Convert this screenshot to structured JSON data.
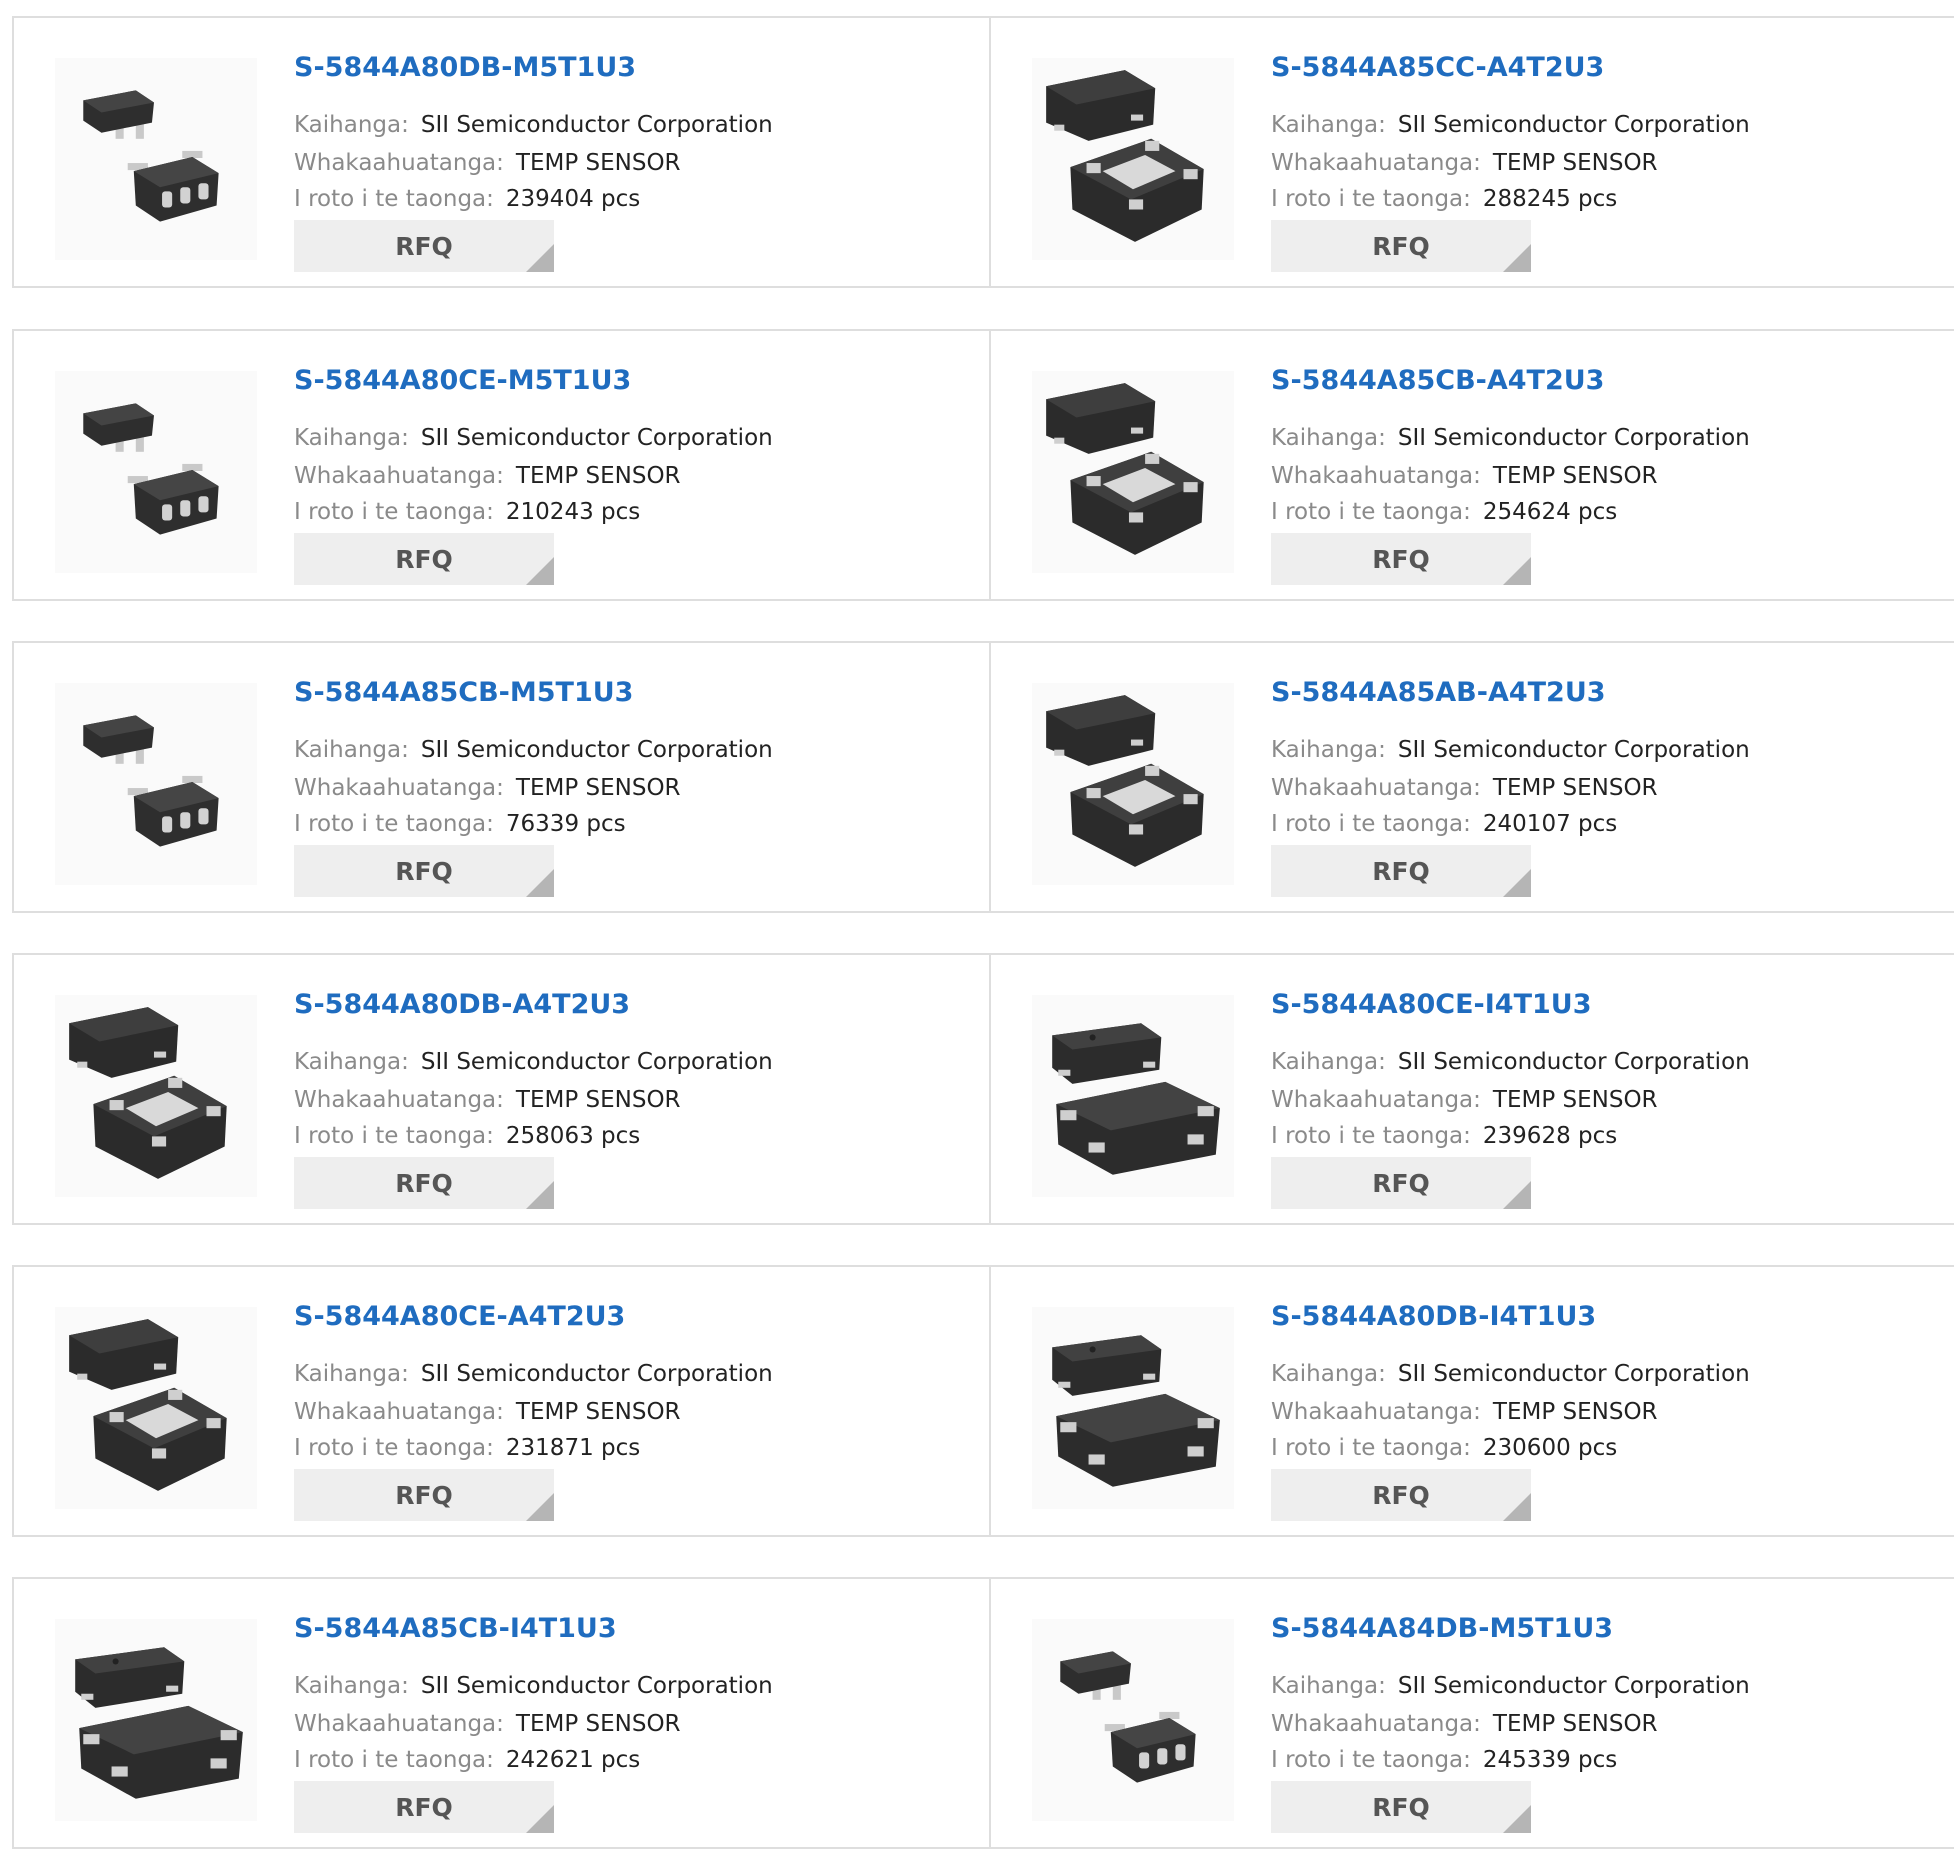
{
  "labels": {
    "manufacturer": "Kaihanga:",
    "description": "Whakaahuatanga:",
    "stock": "I roto i te taonga:",
    "rfq": "RFQ"
  },
  "rows": [
    [
      {
        "part": "S-5844A80DB-M5T1U3",
        "manufacturer": "SII Semiconductor Corporation",
        "description": "TEMP SENSOR",
        "stock": "239404 pcs",
        "image": "sot23-5-package-icon"
      },
      {
        "part": "S-5844A85CC-A4T2U3",
        "manufacturer": "SII Semiconductor Corporation",
        "description": "TEMP SENSOR",
        "stock": "288245 pcs",
        "image": "snt-4a-package-icon"
      }
    ],
    [
      {
        "part": "S-5844A80CE-M5T1U3",
        "manufacturer": "SII Semiconductor Corporation",
        "description": "TEMP SENSOR",
        "stock": "210243 pcs",
        "image": "sot23-5-package-icon"
      },
      {
        "part": "S-5844A85CB-A4T2U3",
        "manufacturer": "SII Semiconductor Corporation",
        "description": "TEMP SENSOR",
        "stock": "254624 pcs",
        "image": "snt-4a-package-icon"
      }
    ],
    [
      {
        "part": "S-5844A85CB-M5T1U3",
        "manufacturer": "SII Semiconductor Corporation",
        "description": "TEMP SENSOR",
        "stock": "76339 pcs",
        "image": "sot23-5-package-icon"
      },
      {
        "part": "S-5844A85AB-A4T2U3",
        "manufacturer": "SII Semiconductor Corporation",
        "description": "TEMP SENSOR",
        "stock": "240107 pcs",
        "image": "snt-4a-package-icon"
      }
    ],
    [
      {
        "part": "S-5844A80DB-A4T2U3",
        "manufacturer": "SII Semiconductor Corporation",
        "description": "TEMP SENSOR",
        "stock": "258063 pcs",
        "image": "snt-4a-package-icon"
      },
      {
        "part": "S-5844A80CE-I4T1U3",
        "manufacturer": "SII Semiconductor Corporation",
        "description": "TEMP SENSOR",
        "stock": "239628 pcs",
        "image": "hsnt-4-package-icon"
      }
    ],
    [
      {
        "part": "S-5844A80CE-A4T2U3",
        "manufacturer": "SII Semiconductor Corporation",
        "description": "TEMP SENSOR",
        "stock": "231871 pcs",
        "image": "snt-4a-package-icon"
      },
      {
        "part": "S-5844A80DB-I4T1U3",
        "manufacturer": "SII Semiconductor Corporation",
        "description": "TEMP SENSOR",
        "stock": "230600 pcs",
        "image": "hsnt-4-package-icon"
      }
    ],
    [
      {
        "part": "S-5844A85CB-I4T1U3",
        "manufacturer": "SII Semiconductor Corporation",
        "description": "TEMP SENSOR",
        "stock": "242621 pcs",
        "image": "hsnt-4-package-icon"
      },
      {
        "part": "S-5844A84DB-M5T1U3",
        "manufacturer": "SII Semiconductor Corporation",
        "description": "TEMP SENSOR",
        "stock": "245339 pcs",
        "image": "sot23-5-package-icon"
      }
    ]
  ]
}
